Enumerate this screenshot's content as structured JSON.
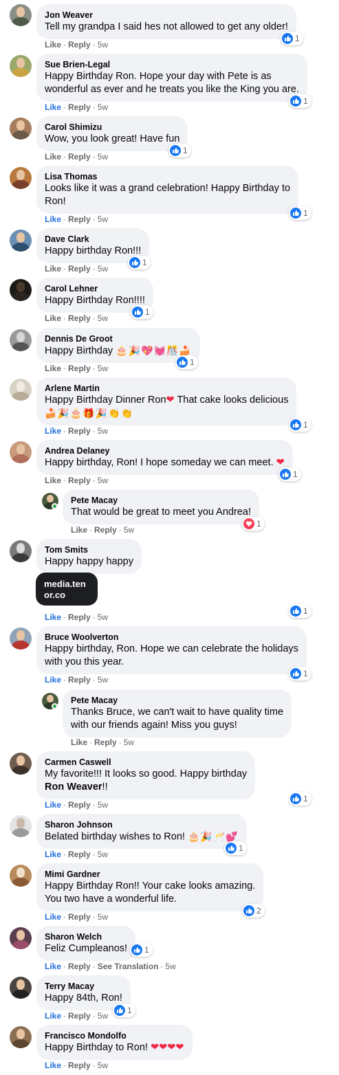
{
  "actions": {
    "like": "Like",
    "reply": "Reply",
    "see_translation": "See Translation",
    "sep": "·"
  },
  "comments": [
    {
      "author": "Jon Weaver",
      "text": "Tell my grandpa I said hes not allowed to get any older!",
      "time": "5w",
      "reactions": {
        "type": "like",
        "count": "1"
      }
    },
    {
      "author": "Sue Brien-Legal",
      "lines": [
        "Happy Birthday Ron. Hope your day with Pete is as",
        "wonderful as ever and he treats you like the King you are."
      ],
      "time": "5w",
      "liked": true,
      "reactions": {
        "type": "like",
        "count": "1"
      }
    },
    {
      "author": "Carol Shimizu",
      "text": "Wow, you look great! Have fun",
      "time": "5w",
      "reactions": {
        "type": "like",
        "count": "1"
      }
    },
    {
      "author": "Lisa Thomas",
      "lines": [
        "Looks like it was a grand celebration! Happy Birthday to",
        "Ron!"
      ],
      "time": "5w",
      "liked": true,
      "reactions": {
        "type": "like",
        "count": "1"
      }
    },
    {
      "author": "Dave Clark",
      "text": "Happy birthday Ron!!!",
      "time": "5w",
      "reactions": {
        "type": "like",
        "count": "1"
      }
    },
    {
      "author": "Carol Lehner",
      "text": "Happy Birthday Ron!!!!",
      "time": "5w",
      "reactions": {
        "type": "like",
        "count": "1"
      }
    },
    {
      "author": "Dennis De Groot",
      "text": "Happy Birthday",
      "emoji": "🎂🎉💖💓🎊🍰",
      "time": "5w",
      "reactions": {
        "type": "like",
        "count": "1"
      }
    },
    {
      "author": "Arlene Martin",
      "text": "Happy Birthday Dinner Ron",
      "heart": "❤",
      "text_after": " That cake looks delicious",
      "emoji": "🍰🎉🎂🎁🎉👏👏",
      "time": "5w",
      "liked": true,
      "reactions": {
        "type": "like",
        "count": "1"
      }
    },
    {
      "author": "Andrea Delaney",
      "text": "Happy birthday, Ron! I hope someday we can meet.",
      "heart": "❤",
      "time": "5w",
      "reactions": {
        "type": "like",
        "count": "1"
      }
    },
    {
      "author": "Pete Macay",
      "text": "That would be great to meet you Andrea!",
      "time": "5w",
      "reactions": {
        "type": "love",
        "count": "1"
      }
    },
    {
      "author": "Tom Smits",
      "text": "Happy happy happy",
      "media": [
        "media.ten",
        "or.co"
      ],
      "time": "5w",
      "liked": true,
      "reactions": {
        "type": "like",
        "count": "1"
      }
    },
    {
      "author": "Bruce Woolverton",
      "lines": [
        "Happy birthday, Ron. Hope we can celebrate the holidays",
        "with you this year."
      ],
      "time": "5w",
      "liked": true,
      "reactions": {
        "type": "like",
        "count": "1"
      }
    },
    {
      "author": "Pete Macay",
      "lines": [
        "Thanks Bruce, we can't wait to have quality time",
        "with our friends again! Miss you guys!"
      ],
      "time": "5w"
    },
    {
      "author": "Carmen Caswell",
      "lines": [
        "My favorite!!! It looks so good. Happy birthday"
      ],
      "tag": "Ron Weaver",
      "tag_after": "!!",
      "time": "5w",
      "liked": true,
      "reactions": {
        "type": "like",
        "count": "1"
      }
    },
    {
      "author": "Sharon Johnson",
      "text": "Belated birthday wishes to Ron!",
      "emoji": "🎂🎉🥂💕",
      "time": "5w",
      "liked": true,
      "reactions": {
        "type": "like",
        "count": "1"
      }
    },
    {
      "author": "Mimi Gardner",
      "lines": [
        "Happy Birthday Ron!! Your cake looks amazing.",
        "You two have a wonderful life."
      ],
      "time": "5w",
      "liked": true,
      "reactions": {
        "type": "like",
        "count": "2"
      }
    },
    {
      "author": "Sharon Welch",
      "text": "Feliz Cumpleanos!",
      "time": "5w",
      "liked": true,
      "reactions": {
        "type": "like",
        "count": "1"
      }
    },
    {
      "author": "Terry Macay",
      "text": "Happy 84th, Ron!",
      "time": "5w",
      "liked": true,
      "reactions": {
        "type": "like",
        "count": "1"
      }
    },
    {
      "author": "Francisco Mondolfo",
      "text": "Happy Birthday to Ron!",
      "hearts": "❤❤❤❤",
      "time": "5w",
      "liked": true
    }
  ]
}
